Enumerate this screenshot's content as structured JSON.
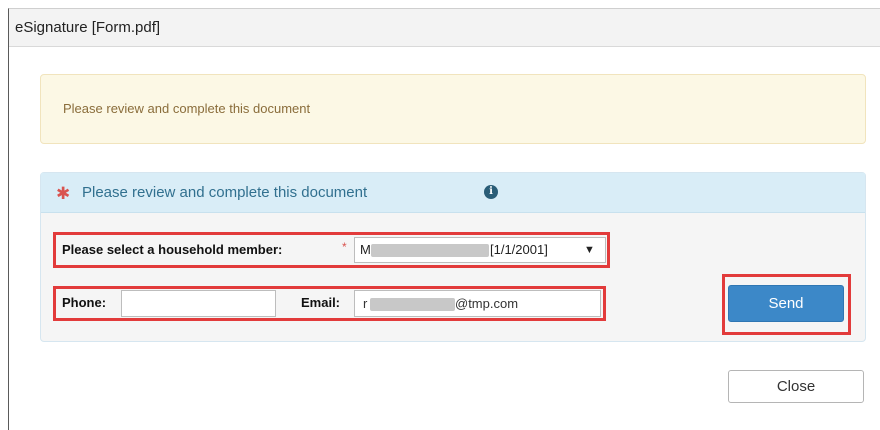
{
  "dialog": {
    "title": "eSignature [Form.pdf]"
  },
  "alert": {
    "message": "Please review and complete this document"
  },
  "panel": {
    "title": "Please review and complete this document",
    "required_star": "✱",
    "info_icon": "info-icon"
  },
  "household": {
    "label": "Please select a household member:",
    "required_mark": "*",
    "selected_prefix": "M",
    "selected_suffix": "[1/1/2001]",
    "caret": "▼"
  },
  "phone": {
    "label": "Phone:",
    "value": ""
  },
  "email": {
    "label": "Email:",
    "value_prefix": "r",
    "value_suffix": "@tmp.com"
  },
  "buttons": {
    "send": "Send",
    "close": "Close"
  },
  "colors": {
    "highlight_outline": "#e23b3b",
    "send_button": "#3c88c8",
    "panel_header": "#d9edf7",
    "alert_background": "#fcf8e5"
  }
}
